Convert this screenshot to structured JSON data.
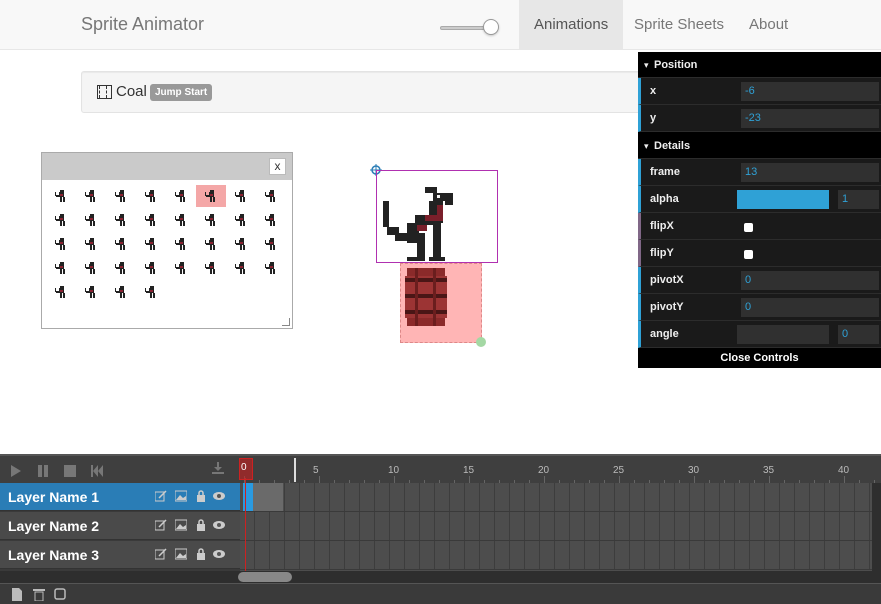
{
  "navbar": {
    "brand": "Sprite Animator",
    "zoom_level": 0.85,
    "items": [
      {
        "label": "Animations",
        "active": true
      },
      {
        "label": "Sprite Sheets",
        "active": false
      },
      {
        "label": "About",
        "active": false
      }
    ]
  },
  "animation": {
    "icon": "film-icon",
    "name": "Coal",
    "tag": "Jump Start"
  },
  "sprite_sheet": {
    "close_label": "x",
    "selected_index": 5,
    "cell_count": 36
  },
  "controls": {
    "position_folder": "Position",
    "x_label": "x",
    "x_value": "-6",
    "y_label": "y",
    "y_value": "-23",
    "details_folder": "Details",
    "frame_label": "frame",
    "frame_value": "13",
    "alpha_label": "alpha",
    "alpha_value": "1",
    "alpha_fraction": 1.0,
    "flipx_label": "flipX",
    "flipx_checked": false,
    "flipy_label": "flipY",
    "flipy_checked": false,
    "pivotx_label": "pivotX",
    "pivotx_value": "0",
    "pivoty_label": "pivotY",
    "pivoty_value": "0",
    "angle_label": "angle",
    "angle_value": "0",
    "angle_fraction": 0,
    "close_label": "Close Controls"
  },
  "timeline": {
    "playhead_frame": "0",
    "ruler_ticks": [
      "5",
      "10",
      "15",
      "20",
      "25",
      "30",
      "35",
      "40"
    ],
    "layers": [
      {
        "name": "Layer Name 1",
        "active": true
      },
      {
        "name": "Layer Name 2",
        "active": false
      },
      {
        "name": "Layer Name 3",
        "active": false
      }
    ],
    "toolbar_icons": [
      "play-icon",
      "pause-icon",
      "stop-icon",
      "rewind-icon",
      "download-icon"
    ],
    "layer_icons": [
      "edit-icon",
      "image-icon",
      "lock-icon",
      "eye-icon"
    ],
    "bottom_icons": [
      "new-layer-icon",
      "trash-icon",
      "square-icon"
    ]
  },
  "colors": {
    "accent_blue": "#2fa1d6",
    "active_layer": "#2a7db6",
    "playhead_red": "#cc2222",
    "selection_pink": "#f4a7a7"
  }
}
